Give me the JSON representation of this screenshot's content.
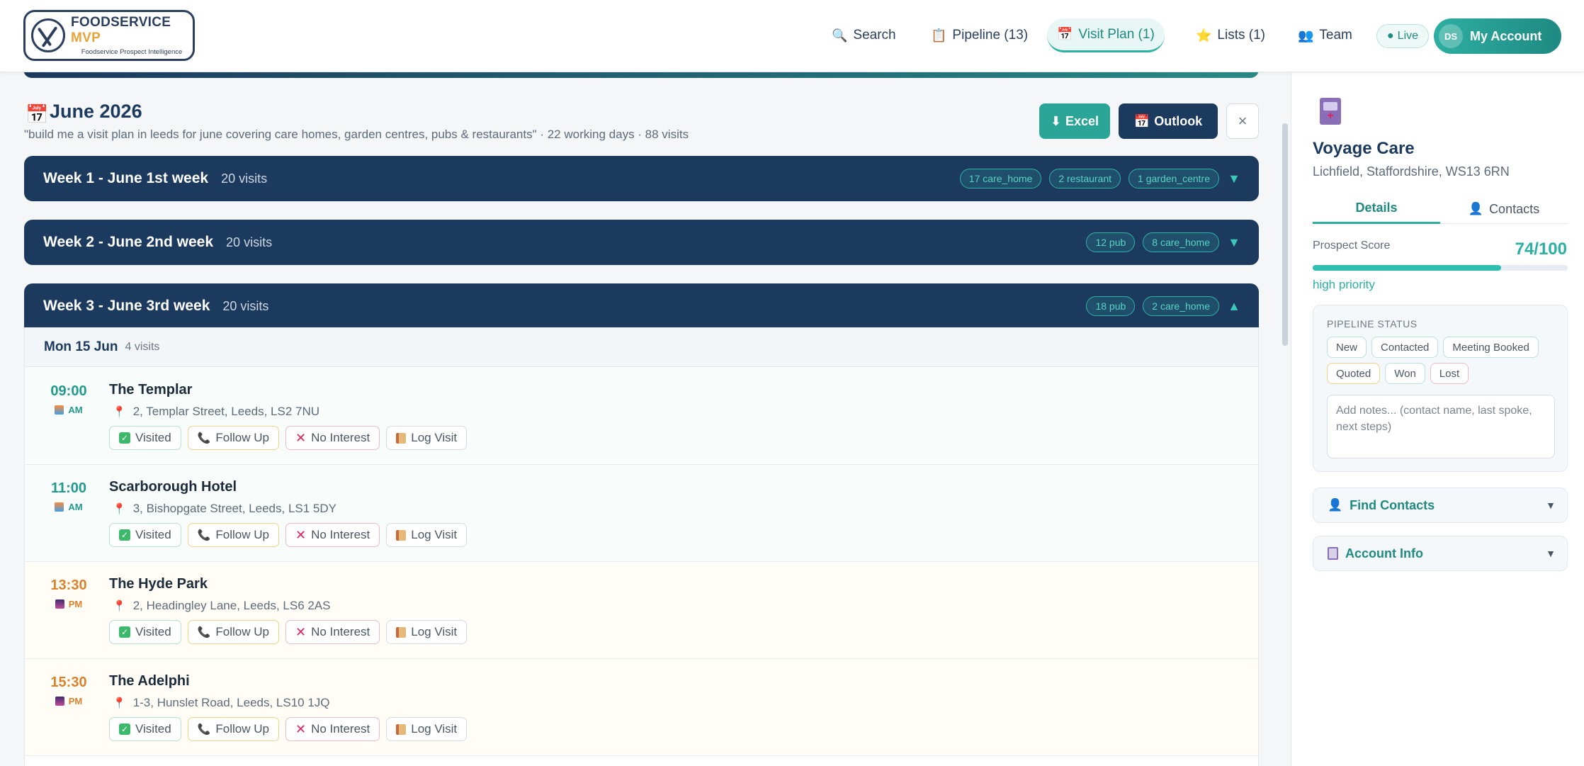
{
  "brand": {
    "title_main": "FOODSERVICE",
    "title_accent": "MVP",
    "subtitle": "Foodservice Prospect Intelligence"
  },
  "nav": {
    "search": "Search",
    "pipeline": "Pipeline (13)",
    "visit_plan": "Visit Plan (1)",
    "lists": "Lists (1)",
    "team": "Team",
    "live": "Live",
    "account_initials": "DS",
    "account_label": "My Account"
  },
  "plan": {
    "title": "June 2026",
    "description": "\"build me a visit plan in leeds for june covering care homes, garden centres, pubs & restaurants\" · 22 working days · 88 visits",
    "excel_label": "Excel",
    "outlook_label": "Outlook",
    "close_label": "×"
  },
  "weeks": [
    {
      "title": "Week 1 - June 1st week",
      "count": "20 visits",
      "tags": [
        "17 care_home",
        "2 restaurant",
        "1 garden_centre"
      ],
      "expanded": false
    },
    {
      "title": "Week 2 - June 2nd week",
      "count": "20 visits",
      "tags": [
        "12 pub",
        "8 care_home"
      ],
      "expanded": false
    },
    {
      "title": "Week 3 - June 3rd week",
      "count": "20 visits",
      "tags": [
        "18 pub",
        "2 care_home"
      ],
      "expanded": true
    }
  ],
  "day": {
    "label": "Mon 15 Jun",
    "count": "4 visits"
  },
  "visits": [
    {
      "time": "09:00",
      "period": "AM",
      "name": "The Templar",
      "address": "2, Templar Street, Leeds, LS2 7NU"
    },
    {
      "time": "11:00",
      "period": "AM",
      "name": "Scarborough Hotel",
      "address": "3, Bishopgate Street, Leeds, LS1 5DY"
    },
    {
      "time": "13:30",
      "period": "PM",
      "name": "The Hyde Park",
      "address": "2, Headingley Lane, Leeds, LS6 2AS"
    },
    {
      "time": "15:30",
      "period": "PM",
      "name": "The Adelphi",
      "address": "1-3, Hunslet Road, Leeds, LS10 1JQ"
    }
  ],
  "actions": {
    "visited": "Visited",
    "follow_up": "Follow Up",
    "no_interest": "No Interest",
    "log_visit": "Log Visit"
  },
  "side": {
    "name": "Voyage Care",
    "location": "Lichfield, Staffordshire, WS13 6RN",
    "tab_details": "Details",
    "tab_contacts": "Contacts",
    "score_label": "Prospect Score",
    "score_value": "74/100",
    "score": 74,
    "priority": "high priority",
    "pipeline_label": "PIPELINE STATUS",
    "statuses": [
      "New",
      "Contacted",
      "Meeting Booked",
      "Quoted",
      "Won",
      "Lost"
    ],
    "notes_placeholder": "Add notes... (contact name, last spoke, next steps)",
    "find_contacts": "Find Contacts",
    "account_info": "Account Info"
  },
  "colors": {
    "navy": "#1c3a5e",
    "teal": "#2bb0a2",
    "amber": "#d9822b",
    "danger": "#e0245e"
  }
}
